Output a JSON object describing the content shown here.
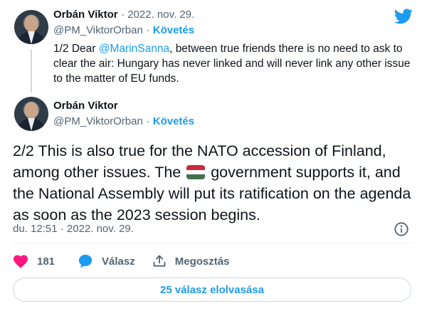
{
  "tweet1": {
    "name": "Orbán Viktor",
    "date": "· 2022. nov. 29.",
    "handle": "@PM_ViktorOrban",
    "dot": "·",
    "follow": "Követés",
    "text_before": "1/2 Dear ",
    "mention": "@MarinSanna",
    "text_after": ", between true friends there is no need to ask to clear the air: Hungary has never linked and will never link any other issue to the matter of EU funds."
  },
  "tweet2": {
    "name": "Orbán Viktor",
    "handle": "@PM_ViktorOrban",
    "dot": "·",
    "follow": "Követés",
    "text_before_flag": "2/2 This is also true for the NATO accession of Finland, among other issues. The ",
    "text_after_flag": " government supports it, and the National Assembly will put its ratification on the agenda as soon as the 2023 session begins.",
    "timestamp": "du. 12:51 · 2022. nov. 29."
  },
  "flag_colors": [
    "#cd2a3e",
    "#ffffff",
    "#436f4d"
  ],
  "actions": {
    "like_count": "181",
    "reply_label": "Válasz",
    "share_label": "Megosztás"
  },
  "read_replies": "25 válasz elolvasása",
  "colors": {
    "accent": "#1d9bf0",
    "like": "#f91880",
    "muted": "#536471"
  },
  "icons": [
    "twitter-bird-icon",
    "info-icon",
    "heart-icon",
    "reply-bubble-icon",
    "share-icon"
  ]
}
